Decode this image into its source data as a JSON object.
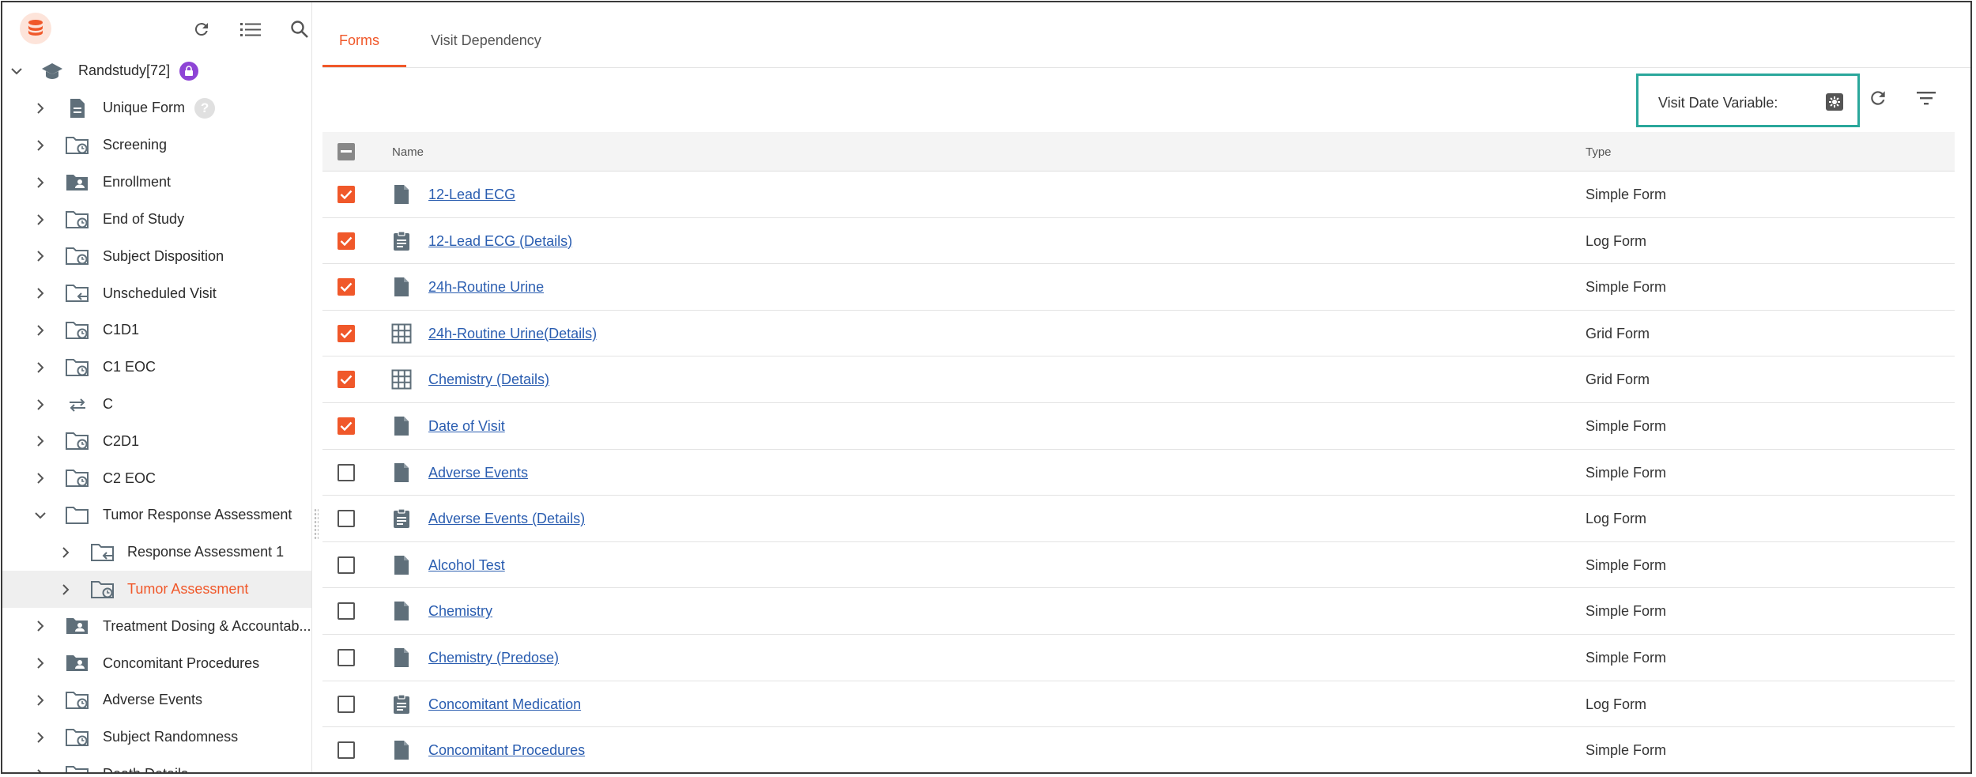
{
  "sidebar": {
    "toolbar": {
      "refresh": "refresh-icon",
      "list": "list-icon",
      "search": "search-icon"
    },
    "study": {
      "label": "Randstudy[72]"
    },
    "items": [
      {
        "label": "Unique Form",
        "icon": "form-icon",
        "badge": "?"
      },
      {
        "label": "Screening",
        "icon": "folder-clock-icon"
      },
      {
        "label": "Enrollment",
        "icon": "folder-person-icon"
      },
      {
        "label": "End of Study",
        "icon": "folder-clock-icon"
      },
      {
        "label": "Subject Disposition",
        "icon": "folder-clock-icon"
      },
      {
        "label": "Unscheduled Visit",
        "icon": "folder-arrow-icon"
      },
      {
        "label": "C1D1",
        "icon": "folder-clock-icon"
      },
      {
        "label": "C1 EOC",
        "icon": "folder-clock-icon"
      },
      {
        "label": "C",
        "icon": "repeat-icon"
      },
      {
        "label": "C2D1",
        "icon": "folder-clock-icon"
      },
      {
        "label": "C2 EOC",
        "icon": "folder-clock-icon"
      },
      {
        "label": "Tumor Response Assessment",
        "icon": "folder-icon"
      },
      {
        "label": "Response Assessment 1",
        "icon": "folder-arrow-icon"
      },
      {
        "label": "Tumor Assessment",
        "icon": "folder-clock-icon"
      },
      {
        "label": "Treatment Dosing & Accountab...",
        "icon": "folder-person-icon"
      },
      {
        "label": "Concomitant Procedures",
        "icon": "folder-person-icon"
      },
      {
        "label": "Adverse Events",
        "icon": "folder-clock-icon"
      },
      {
        "label": "Subject Randomness",
        "icon": "folder-clock-icon"
      },
      {
        "label": "Death Details",
        "icon": "folder-clock-icon"
      }
    ]
  },
  "tabs": [
    {
      "label": "Forms",
      "active": true
    },
    {
      "label": "Visit Dependency",
      "active": false
    }
  ],
  "actions": {
    "visit_date_label": "Visit Date Variable:",
    "refresh": "refresh-icon",
    "filter": "filter-icon"
  },
  "table": {
    "headers": {
      "name": "Name",
      "type": "Type"
    },
    "rows": [
      {
        "name": "12-Lead ECG",
        "type": "Simple Form",
        "checked": true,
        "icon": "simple-form-icon"
      },
      {
        "name": "12-Lead ECG (Details)",
        "type": "Log Form",
        "checked": true,
        "icon": "log-form-icon"
      },
      {
        "name": "24h-Routine Urine",
        "type": "Simple Form",
        "checked": true,
        "icon": "simple-form-icon"
      },
      {
        "name": "24h-Routine Urine(Details)",
        "type": "Grid Form",
        "checked": true,
        "icon": "grid-form-icon"
      },
      {
        "name": "Chemistry (Details)",
        "type": "Grid Form",
        "checked": true,
        "icon": "grid-form-icon"
      },
      {
        "name": "Date of Visit",
        "type": "Simple Form",
        "checked": true,
        "icon": "simple-form-icon"
      },
      {
        "name": "Adverse Events",
        "type": "Simple Form",
        "checked": false,
        "icon": "simple-form-icon"
      },
      {
        "name": "Adverse Events (Details)",
        "type": "Log Form",
        "checked": false,
        "icon": "log-form-icon"
      },
      {
        "name": "Alcohol Test",
        "type": "Simple Form",
        "checked": false,
        "icon": "simple-form-icon"
      },
      {
        "name": "Chemistry",
        "type": "Simple Form",
        "checked": false,
        "icon": "simple-form-icon"
      },
      {
        "name": "Chemistry (Predose)",
        "type": "Simple Form",
        "checked": false,
        "icon": "simple-form-icon"
      },
      {
        "name": "Concomitant Medication",
        "type": "Log Form",
        "checked": false,
        "icon": "log-form-icon"
      },
      {
        "name": "Concomitant Procedures",
        "type": "Simple Form",
        "checked": false,
        "icon": "simple-form-icon"
      }
    ]
  },
  "colors": {
    "accent": "#f0582a",
    "link": "#2a5db0",
    "highlight_box": "#2aa79b",
    "icon": "#5f6f7a",
    "lock_badge": "#8e44d6"
  }
}
